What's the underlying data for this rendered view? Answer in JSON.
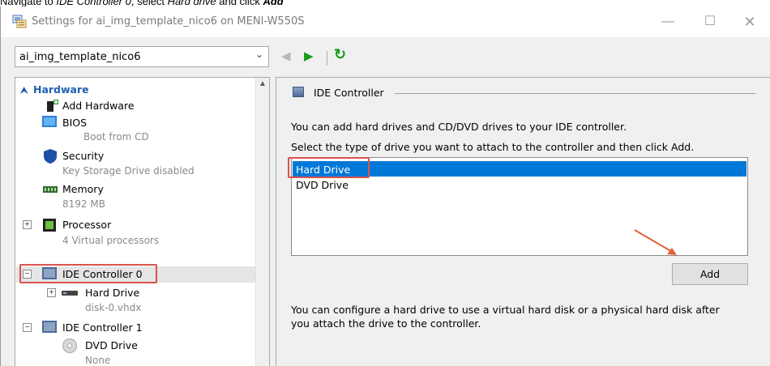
{
  "caption": {
    "prefix": "Navigate to ",
    "target": "IDE Controller 0",
    "middle": ", select ",
    "item": "Hard drive",
    "suffix": " and click ",
    "action": "Add"
  },
  "window": {
    "title": "Settings for ai_img_template_nico6 on MENI-W550S",
    "vm_selector": "ai_img_template_nico6"
  },
  "tree": {
    "hardware_header": "Hardware",
    "items": [
      {
        "label": "Add Hardware",
        "sub": ""
      },
      {
        "label": "BIOS",
        "sub": "Boot from CD"
      },
      {
        "label": "Security",
        "sub": "Key Storage Drive disabled"
      },
      {
        "label": "Memory",
        "sub": "8192 MB"
      },
      {
        "label": "Processor",
        "sub": "4 Virtual processors"
      },
      {
        "label": "IDE Controller 0",
        "sub": ""
      },
      {
        "label": "Hard Drive",
        "sub": "disk-0.vhdx"
      },
      {
        "label": "IDE Controller 1",
        "sub": ""
      },
      {
        "label": "DVD Drive",
        "sub": "None"
      }
    ]
  },
  "panel": {
    "group_title": "IDE Controller",
    "intro": "You can add hard drives and CD/DVD drives to your IDE controller.",
    "instruction": "Select the type of drive you want to attach to the controller and then click Add.",
    "drive_types": [
      "Hard Drive",
      "DVD Drive"
    ],
    "selected_drive": "Hard Drive",
    "add_button": "Add",
    "footer_line1": "You can configure a hard drive to use a virtual hard disk or a physical hard disk after",
    "footer_line2": "you attach the drive to the controller."
  },
  "colors": {
    "selection": "#0078d7",
    "highlight_box": "#d9534f",
    "header_blue": "#1f5eb3",
    "nav_green": "#1a9a1a"
  }
}
